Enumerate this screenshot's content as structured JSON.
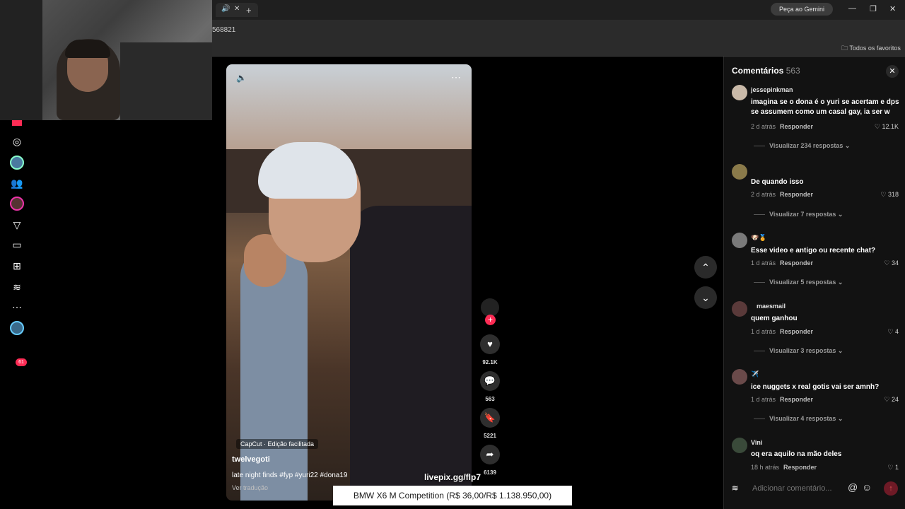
{
  "browser": {
    "url_fragment": "568821",
    "gemini_button": "Peça ao Gemini",
    "bookmarks_label": "Todos os favoritos"
  },
  "nav": {
    "inbox_badge": "61"
  },
  "video": {
    "capcut_label": "CapCut · Edição facilitada",
    "username": "twelvegoti",
    "description": "late night finds #fyp #yuri22 #dona19",
    "translate_link": "Ver tradução",
    "likes": "92.1K",
    "comments": "563",
    "saves": "5221",
    "shares": "6139"
  },
  "overlay": {
    "livepix": "livepix.gg/flp7",
    "donation_goal": "BMW X6 M Competition (R$ 36,00/R$ 1.138.950,00)"
  },
  "comments": {
    "title": "Comentários",
    "count": "563",
    "input_placeholder": "Adicionar comentário...",
    "items": [
      {
        "user": "jessepinkman",
        "text": "imagina se o dona é o yuri se acertam e dps se assumem como um casal gay, ia ser w",
        "time": "2 d atrás",
        "reply": "Responder",
        "likes": "12.1K",
        "view_replies": "Visualizar 234 respostas"
      },
      {
        "user": "",
        "text": "De quando isso",
        "time": "2 d atrás",
        "reply": "Responder",
        "likes": "318",
        "view_replies": "Visualizar 7 respostas"
      },
      {
        "user": "",
        "text": "Esse video e antigo ou recente chat?",
        "time": "1 d atrás",
        "reply": "Responder",
        "likes": "34",
        "view_replies": "Visualizar 5 respostas"
      },
      {
        "user": "maesmail",
        "text": "quem ganhou",
        "time": "1 d atrás",
        "reply": "Responder",
        "likes": "4",
        "view_replies": "Visualizar 3 respostas"
      },
      {
        "user": "",
        "text": "ice nuggets x real gotis vai ser amnh?",
        "time": "1 d atrás",
        "reply": "Responder",
        "likes": "24",
        "view_replies": "Visualizar 4 respostas"
      },
      {
        "user": "Vini",
        "text": "oq era aquilo na mão deles",
        "time": "18 h atrás",
        "reply": "Responder",
        "likes": "1",
        "view_replies": ""
      }
    ]
  }
}
